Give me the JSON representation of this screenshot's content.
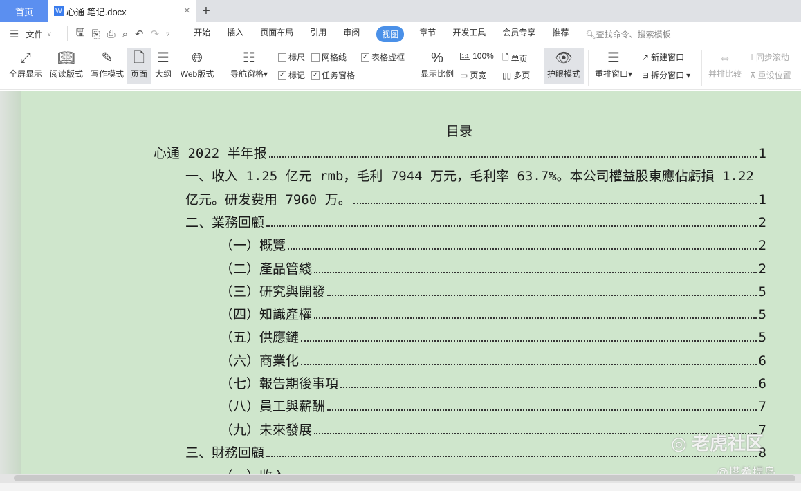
{
  "tabs": {
    "home": "首页",
    "doc": "心通 笔记.docx",
    "doc_icon": "W",
    "close": "×",
    "new": "+"
  },
  "menu": {
    "file": "文件",
    "items": [
      "开始",
      "插入",
      "页面布局",
      "引用",
      "审阅",
      "视图",
      "章节",
      "开发工具",
      "会员专享",
      "推荐"
    ],
    "active_index": 5,
    "search": "查找命令、搜索模板"
  },
  "ribbon": {
    "fullscreen": "全屏显示",
    "read": "阅读版式",
    "write": "写作模式",
    "page": "页面",
    "outline": "大纲",
    "web": "Web版式",
    "nav": "导航窗格",
    "ruler": "标尺",
    "grid": "网格线",
    "table_frame": "表格虚框",
    "mark": "标记",
    "task_pane": "任务窗格",
    "zoom_ratio": "显示比例",
    "zoom100": "100%",
    "page_width": "页宽",
    "single": "单页",
    "multi": "多页",
    "eye": "护眼模式",
    "arrange": "重排窗口",
    "new_window": "新建窗口",
    "split": "拆分窗口",
    "side_by_side": "并排比较",
    "sync_scroll": "同步滚动",
    "reset_pos": "重设位置",
    "checks": {
      "ruler": false,
      "grid": false,
      "table_frame": true,
      "mark": true,
      "task_pane": true
    }
  },
  "document": {
    "title": "目录",
    "entries": [
      {
        "text": "心通 2022 半年报",
        "page": "1",
        "level": 0
      },
      {
        "text": "一、收入 1.25 亿元 rmb，毛利 7944 万元，毛利率 63.7%。本公司權益股東應佔虧損 1.22",
        "page": "",
        "level": 1
      },
      {
        "text": "亿元。研发费用 7960 万。",
        "page": "1",
        "level": 1
      },
      {
        "text": "二、業務回顧",
        "page": "2",
        "level": 1
      },
      {
        "text": "（一）概覽",
        "page": "2",
        "level": 2
      },
      {
        "text": "（二）產品管綫",
        "page": "2",
        "level": 2
      },
      {
        "text": "（三）研究與開發",
        "page": "5",
        "level": 2
      },
      {
        "text": "（四）知識產權",
        "page": "5",
        "level": 2
      },
      {
        "text": "（五）供應鏈",
        "page": "5",
        "level": 2
      },
      {
        "text": "（六）商業化",
        "page": "6",
        "level": 2
      },
      {
        "text": "（七）報告期後事項",
        "page": "6",
        "level": 2
      },
      {
        "text": "（八）員工與薪酬",
        "page": "7",
        "level": 2
      },
      {
        "text": "（九）未來發展",
        "page": "7",
        "level": 2
      },
      {
        "text": "三、財務回顧",
        "page": "8",
        "level": 1
      },
      {
        "text": "（一）收入",
        "page": "",
        "level": 2
      }
    ]
  },
  "watermark": {
    "main": "老虎社区",
    "sub": "@塔希提岛"
  }
}
